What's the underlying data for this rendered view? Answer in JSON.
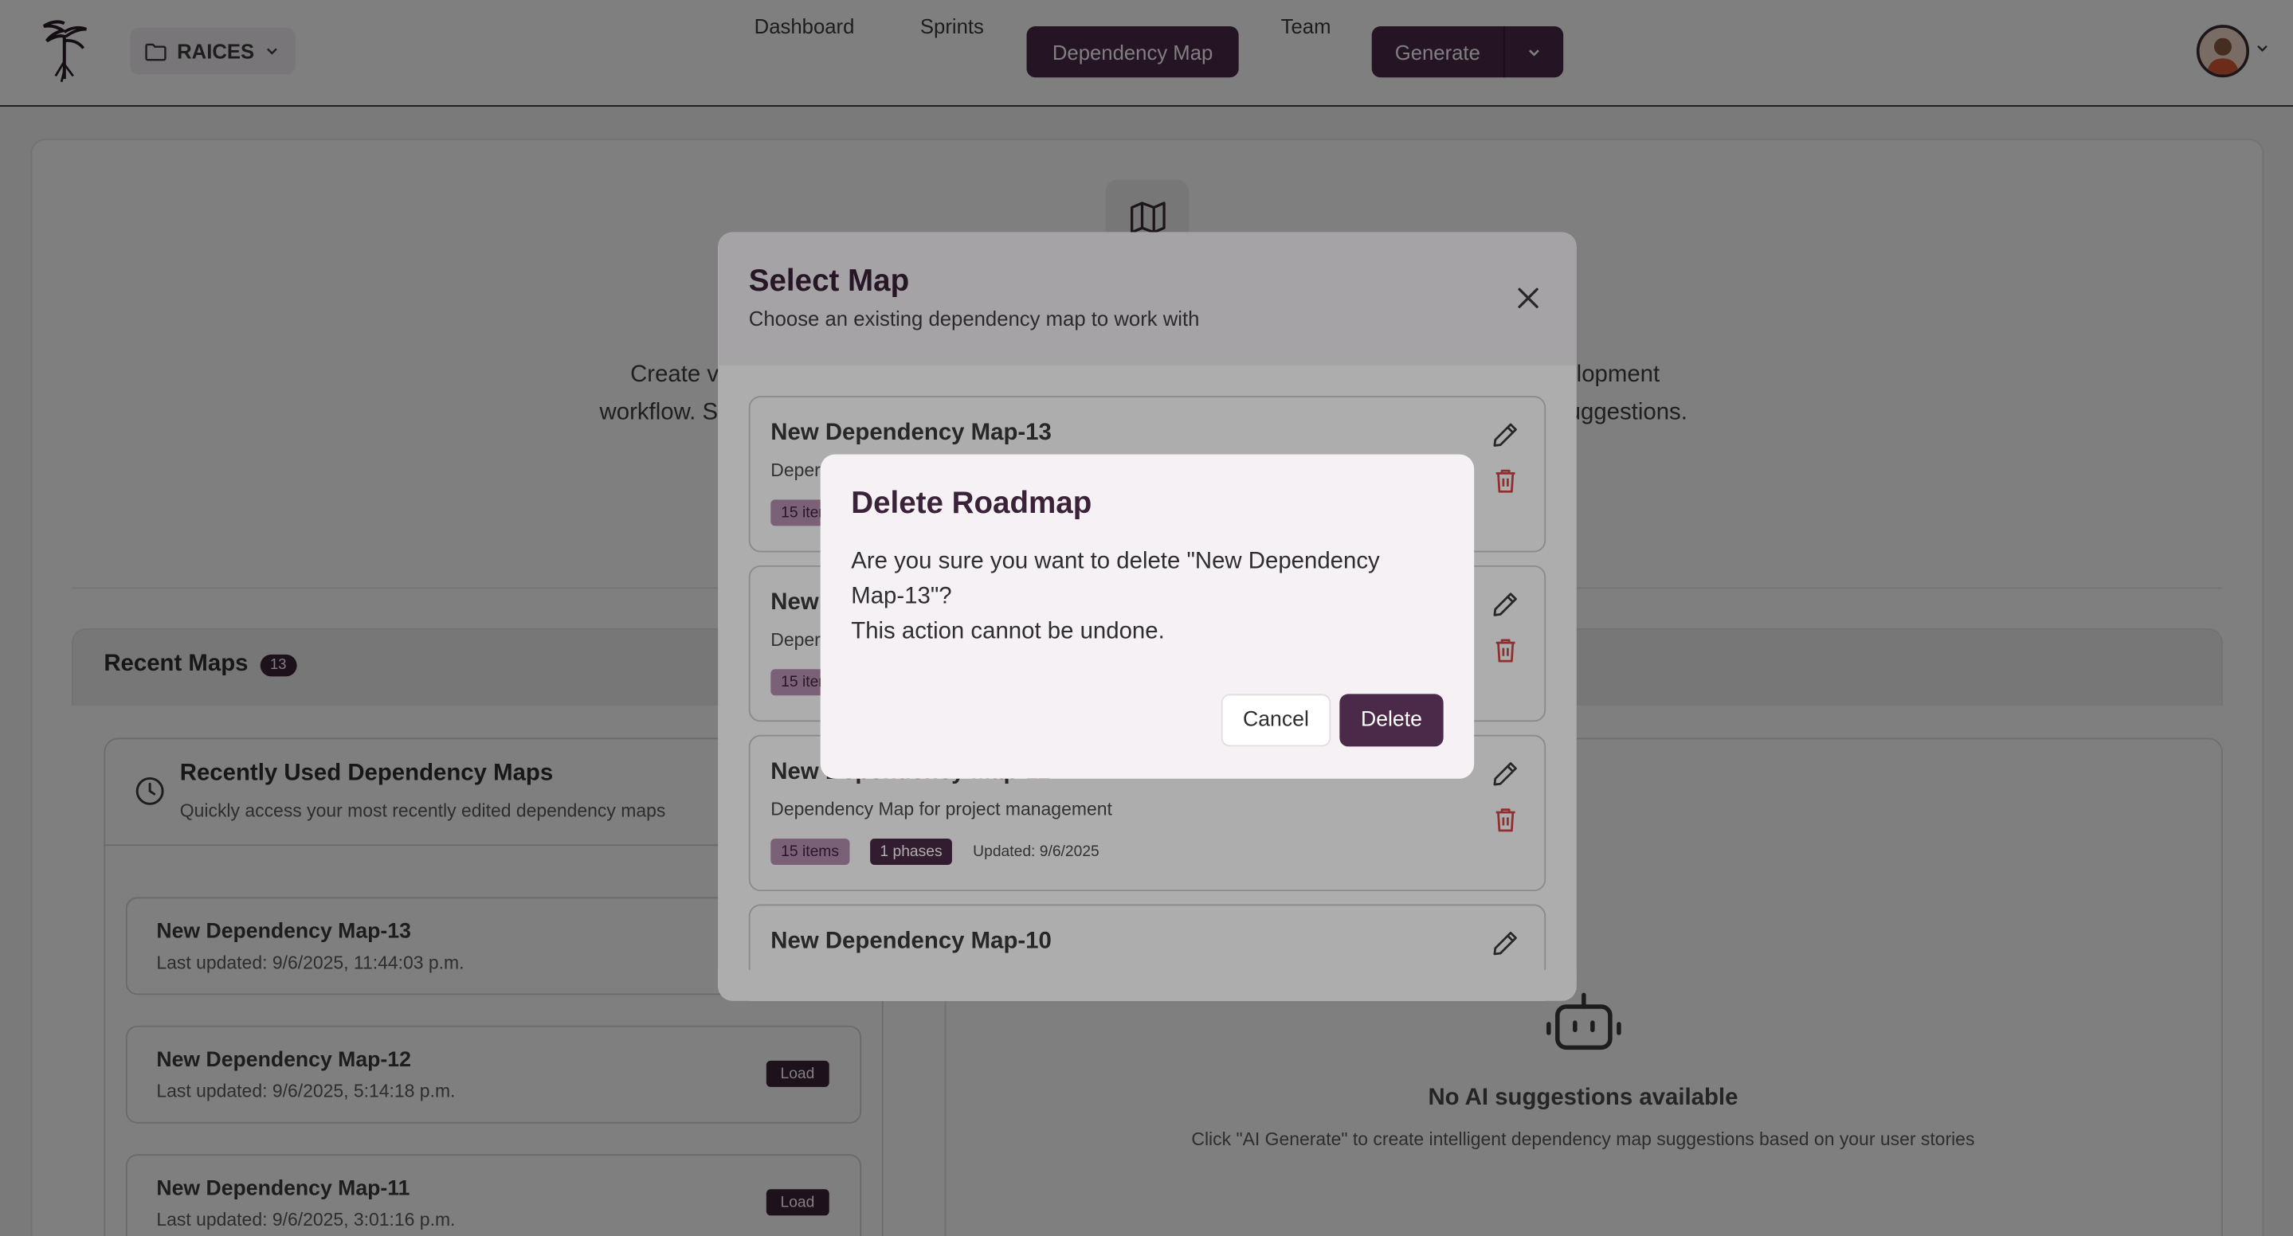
{
  "header": {
    "project_name": "RAICES",
    "nav": [
      "Dashboard",
      "Sprints",
      "Dependency Map",
      "Team"
    ],
    "active_nav": "Dependency Map",
    "generate_label": "Generate"
  },
  "hero": {
    "line1_left": "Create v",
    "line1_right": "lopment",
    "line2_left": "workflow. S",
    "line2_right": "uggestions."
  },
  "recent": {
    "title": "Recent Maps",
    "count": "13",
    "card_title": "Recently Used Dependency Maps",
    "card_subtitle": "Quickly access your most recently edited dependency maps",
    "items": [
      {
        "name": "New Dependency Map-13",
        "updated": "Last updated: 9/6/2025, 11:44:03 p.m.",
        "load": ""
      },
      {
        "name": "New Dependency Map-12",
        "updated": "Last updated: 9/6/2025, 5:14:18 p.m.",
        "load": "Load"
      },
      {
        "name": "New Dependency Map-11",
        "updated": "Last updated: 9/6/2025, 3:01:16 p.m.",
        "load": "Load"
      }
    ]
  },
  "ai": {
    "empty_title": "No AI suggestions available",
    "empty_subtitle": "Click \"AI Generate\" to create intelligent dependency map suggestions based on your user stories"
  },
  "select_modal": {
    "title": "Select Map",
    "subtitle": "Choose an existing dependency map to work with",
    "maps": [
      {
        "title": "New Dependency Map-13",
        "desc": "Deper",
        "items": "15 iter",
        "phases": "",
        "updated": ""
      },
      {
        "title": "New",
        "desc": "Deper",
        "items": "15 iter",
        "phases": "",
        "updated": ""
      },
      {
        "title": "New Dependency Map-11",
        "desc": "Dependency Map for project management",
        "items": "15 items",
        "phases": "1 phases",
        "updated": "Updated: 9/6/2025"
      },
      {
        "title": "New Dependency Map-10",
        "desc": "",
        "items": "",
        "phases": "",
        "updated": ""
      }
    ]
  },
  "delete_dialog": {
    "title": "Delete Roadmap",
    "message_line1": "Are you sure you want to delete \"New Dependency",
    "message_line2": "Map-13\"?",
    "message_line3": "This action cannot be undone.",
    "cancel_label": "Cancel",
    "delete_label": "Delete"
  },
  "icons": {
    "logo": "tree-logo-icon",
    "folder": "folder-icon",
    "map": "map-icon",
    "clock": "clock-icon",
    "bot": "bot-icon",
    "edit": "pencil-icon",
    "trash": "trash-icon",
    "close": "close-icon"
  },
  "colors": {
    "primary": "#4a2a48",
    "tag_light": "#b490b0",
    "danger": "#d64545"
  }
}
